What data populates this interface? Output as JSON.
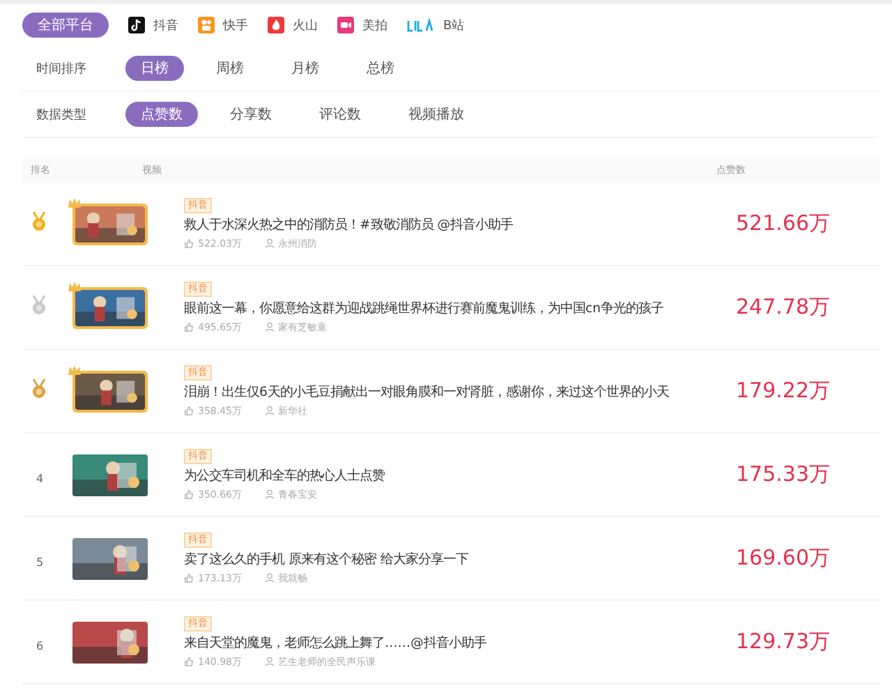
{
  "platforms": [
    {
      "label": "全部平台",
      "kind": "all",
      "selected": true
    },
    {
      "label": "抖音",
      "kind": "douyin",
      "selected": false
    },
    {
      "label": "快手",
      "kind": "kuaishou",
      "selected": false
    },
    {
      "label": "火山",
      "kind": "huoshan",
      "selected": false
    },
    {
      "label": "美拍",
      "kind": "meipai",
      "selected": false
    },
    {
      "label": "B站",
      "kind": "bilibili",
      "selected": false
    }
  ],
  "filters": [
    {
      "label": "时间排序",
      "options": [
        {
          "label": "日榜",
          "selected": true
        },
        {
          "label": "周榜",
          "selected": false
        },
        {
          "label": "月榜",
          "selected": false
        },
        {
          "label": "总榜",
          "selected": false
        }
      ]
    },
    {
      "label": "数据类型",
      "options": [
        {
          "label": "点赞数",
          "selected": true
        },
        {
          "label": "分享数",
          "selected": false
        },
        {
          "label": "评论数",
          "selected": false
        },
        {
          "label": "视频播放",
          "selected": false
        }
      ]
    }
  ],
  "table": {
    "columns": [
      "排名",
      "视频",
      "点赞数"
    ],
    "rows": [
      {
        "color": "#f2b01e",
        "crown": true,
        "tag": "抖音",
        "title": "救人于水深火热之中的消防员！#致敬消防员 @抖音小助手",
        "likes": "522.03万",
        "author": "永州消防",
        "value": "521.66万"
      },
      {
        "color": "#c9c9c9",
        "crown": true,
        "tag": "抖音",
        "title": "眼前这一幕，你愿意给这群为迎战跳绳世界杯进行赛前魔鬼训练，为中国cn争光的孩子",
        "likes": "495.65万",
        "author": "家有芝敏童",
        "value": "247.78万"
      },
      {
        "color": "#d9a441",
        "crown": true,
        "tag": "抖音",
        "title": "泪崩！出生仅6天的小毛豆捐献出一对眼角膜和一对肾脏，感谢你，来过这个世界的小天",
        "likes": "358.45万",
        "author": "新华社",
        "value": "179.22万"
      },
      {
        "rank": "4",
        "crown": false,
        "tag": "抖音",
        "title": "为公交车司机和全车的热心人士点赞",
        "likes": "350.66万",
        "author": "青春宝安",
        "value": "175.33万"
      },
      {
        "rank": "5",
        "crown": false,
        "tag": "抖音",
        "title": "卖了这么久的手机 原来有这个秘密 给大家分享一下",
        "likes": "173.13万",
        "author": "我就畅",
        "value": "169.60万"
      },
      {
        "rank": "6",
        "crown": false,
        "tag": "抖音",
        "title": "来自天堂的魔鬼，老师怎么跳上舞了……@抖音小助手",
        "likes": "140.98万",
        "author": "艺生老师的全民声乐课",
        "value": "129.73万"
      }
    ]
  }
}
